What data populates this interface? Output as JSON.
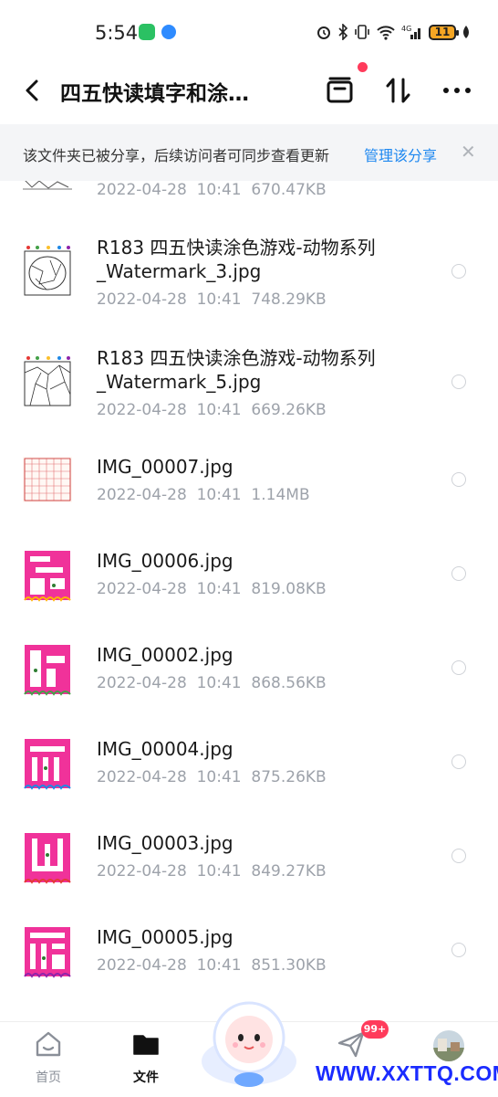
{
  "status_bar": {
    "time": "5:54",
    "battery": "11",
    "network": "4G"
  },
  "nav": {
    "title": "四五快读填字和涂…"
  },
  "banner": {
    "text": "该文件夹已被分享，后续访问者可同步查看更新",
    "action": "管理该分享",
    "close": "✕"
  },
  "files": [
    {
      "name": "",
      "date": "2022-04-28",
      "time": "10:41",
      "size": "670.47KB",
      "thumb": "sketch"
    },
    {
      "name": "R183 四五快读涂色游戏-动物系列_Watermark_3.jpg",
      "date": "2022-04-28",
      "time": "10:41",
      "size": "748.29KB",
      "thumb": "color-animal"
    },
    {
      "name": "R183 四五快读涂色游戏-动物系列_Watermark_5.jpg",
      "date": "2022-04-28",
      "time": "10:41",
      "size": "669.26KB",
      "thumb": "color-animal2"
    },
    {
      "name": "IMG_00007.jpg",
      "date": "2022-04-28",
      "time": "10:41",
      "size": "1.14MB",
      "thumb": "grid-sheet"
    },
    {
      "name": "IMG_00006.jpg",
      "date": "2022-04-28",
      "time": "10:41",
      "size": "819.08KB",
      "thumb": "crossword-pink"
    },
    {
      "name": "IMG_00002.jpg",
      "date": "2022-04-28",
      "time": "10:41",
      "size": "868.56KB",
      "thumb": "crossword-pink"
    },
    {
      "name": "IMG_00004.jpg",
      "date": "2022-04-28",
      "time": "10:41",
      "size": "875.26KB",
      "thumb": "crossword-pink"
    },
    {
      "name": "IMG_00003.jpg",
      "date": "2022-04-28",
      "time": "10:41",
      "size": "849.27KB",
      "thumb": "crossword-pink"
    },
    {
      "name": "IMG_00005.jpg",
      "date": "2022-04-28",
      "time": "10:41",
      "size": "851.30KB",
      "thumb": "crossword-pink"
    }
  ],
  "tabs": [
    {
      "label": "首页",
      "icon": "home-icon",
      "active": false
    },
    {
      "label": "文件",
      "icon": "folder-icon",
      "active": true
    },
    {
      "label": "",
      "icon": "share-plane-icon",
      "active": false
    },
    {
      "label": "",
      "icon": "avatar",
      "active": false
    }
  ],
  "share_badge": "99+",
  "watermark": "WWW.XXTTQ.COM",
  "colors": {
    "accent": "#1e88f0",
    "badge": "#ff3b5b",
    "pink": "#f0329a",
    "meta_gray": "#9da2aa"
  }
}
